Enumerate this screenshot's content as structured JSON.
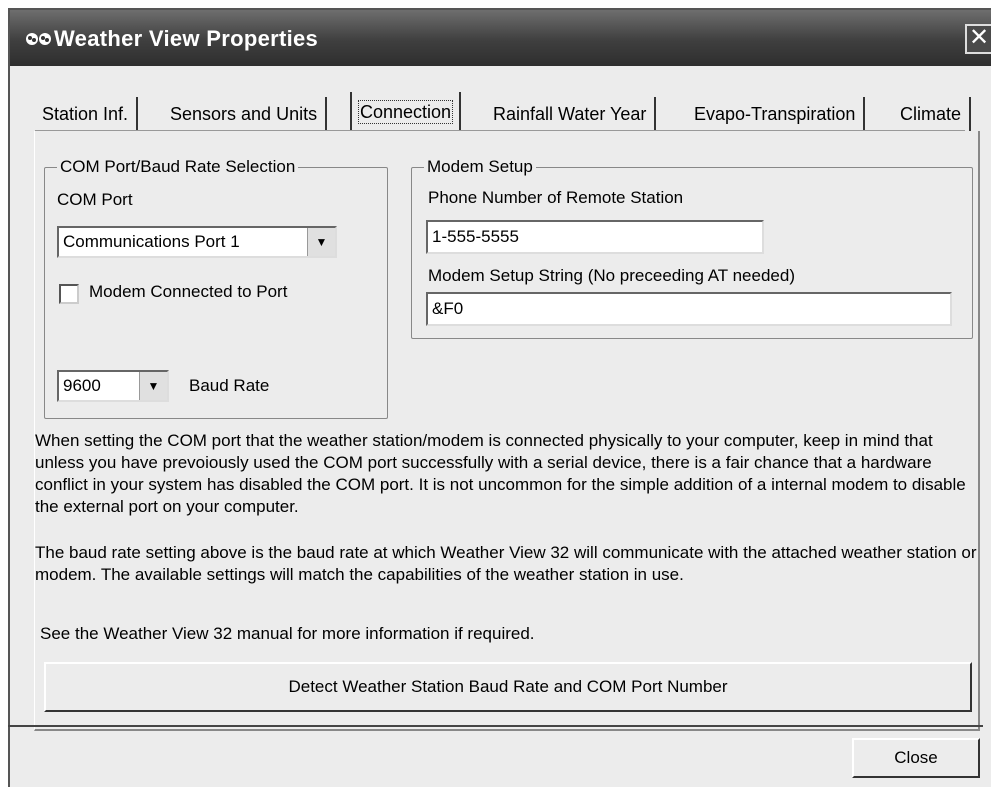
{
  "window": {
    "title": "Weather View Properties",
    "close_glyph": "✕"
  },
  "tabs": [
    {
      "label": "Station Inf.",
      "active": false
    },
    {
      "label": "Sensors and Units",
      "active": false
    },
    {
      "label": "Connection",
      "active": true
    },
    {
      "label": "Rainfall Water Year",
      "active": false
    },
    {
      "label": "Evapo-Transpiration",
      "active": false
    },
    {
      "label": "Climate",
      "active": false
    }
  ],
  "com_group": {
    "legend": "COM Port/Baud Rate Selection",
    "com_port_label": "COM Port",
    "com_port_value": "Communications Port 1",
    "modem_checkbox_label": "Modem Connected to Port",
    "modem_checked": false,
    "baud_value": "9600",
    "baud_label": "Baud Rate"
  },
  "modem_group": {
    "legend": "Modem Setup",
    "phone_label": "Phone Number of Remote Station",
    "phone_value": "1-555-5555",
    "setup_label": "Modem Setup String (No preceeding AT needed)",
    "setup_value": "&F0"
  },
  "info": {
    "para1": "When setting the COM port that the weather station/modem is connected physically to your computer, keep in mind that unless you have prevoiously used the COM port successfully with a serial device, there is a fair chance that a hardware conflict in your system has disabled the COM port. It is not uncommon for the simple addition of a internal modem to disable the external port on your computer.",
    "para2": "The baud rate setting above is the baud rate at which Weather View 32 will communicate with the attached weather station or modem. The available settings will match the capabilities of the weather station in use.",
    "para3": "See the Weather View 32 manual for more information if required."
  },
  "buttons": {
    "detect": "Detect Weather Station Baud Rate and COM Port Number",
    "close": "Close"
  },
  "icons": {
    "app": "paw-icon",
    "dropdown": "dropdown-arrow-icon",
    "close": "close-icon"
  }
}
